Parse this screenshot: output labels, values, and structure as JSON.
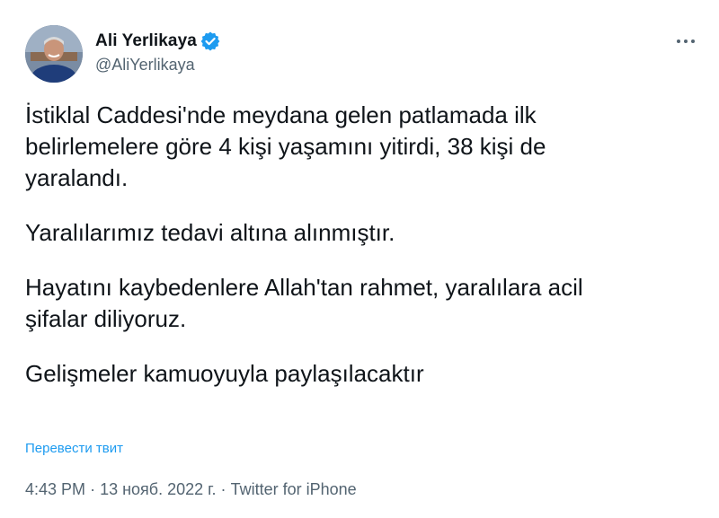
{
  "author": {
    "display_name": "Ali Yerlikaya",
    "handle": "@AliYerlikaya",
    "verified": true,
    "avatar_icon": "profile-photo"
  },
  "tweet": {
    "paragraphs": [
      "İstiklal Caddesi'nde meydana gelen patlamada ilk\nbelirlemelere göre 4 kişi yaşamını yitirdi, 38 kişi de\nyaralandı.",
      "Yaralılarımız tedavi altına alınmıştır.",
      "Hayatını kaybedenlere Allah'tan rahmet, yaralılara acil\nşifalar diliyoruz.",
      "Gelişmeler kamuoyuyla paylaşılacaktır"
    ],
    "translate_label": "Перевести твит",
    "time": "4:43 PM",
    "separator": "·",
    "date": "13 нояб. 2022 г.",
    "source": "Twitter for iPhone"
  },
  "colors": {
    "accent": "#1d9bf0",
    "text": "#0f1419",
    "muted": "#536471"
  }
}
